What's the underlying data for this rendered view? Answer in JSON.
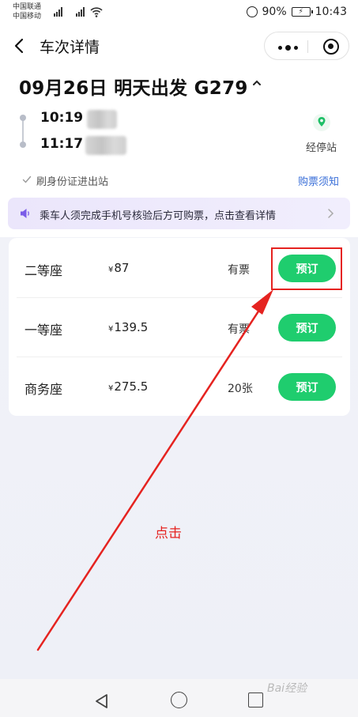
{
  "status_bar": {
    "carrier_1": "中国联通",
    "carrier_2": "中国移动",
    "net_1": "4G",
    "net_2": "2G",
    "battery_percent": "90%",
    "time": "10:43"
  },
  "nav": {
    "title": "车次详情",
    "icons": [
      "back-arrow-icon",
      "more-dots-icon",
      "close-target-icon"
    ]
  },
  "trip": {
    "title": "09月26日 明天出发 G279",
    "depart_time": "10:19",
    "arrive_time": "11:17",
    "stops_label": "经停站",
    "id_note": "刷身份证进出站",
    "notice_link": "购票须知"
  },
  "banner": {
    "text": "乘车人须完成手机号核验后方可购票，点击查看详情"
  },
  "seats": [
    {
      "name": "二等座",
      "currency": "¥",
      "price": "87",
      "availability": "有票",
      "button": "预订"
    },
    {
      "name": "一等座",
      "currency": "¥",
      "price": "139.5",
      "availability": "有票",
      "button": "预订"
    },
    {
      "name": "商务座",
      "currency": "¥",
      "price": "275.5",
      "availability": "20张",
      "button": "预订"
    }
  ],
  "annotation": {
    "text": "点击",
    "color": "#e52320"
  },
  "watermark": "Bai经验",
  "colors": {
    "accent_green": "#1fcd6e",
    "link_blue": "#3a6fd8",
    "banner_purple": "#ebe6fb"
  }
}
